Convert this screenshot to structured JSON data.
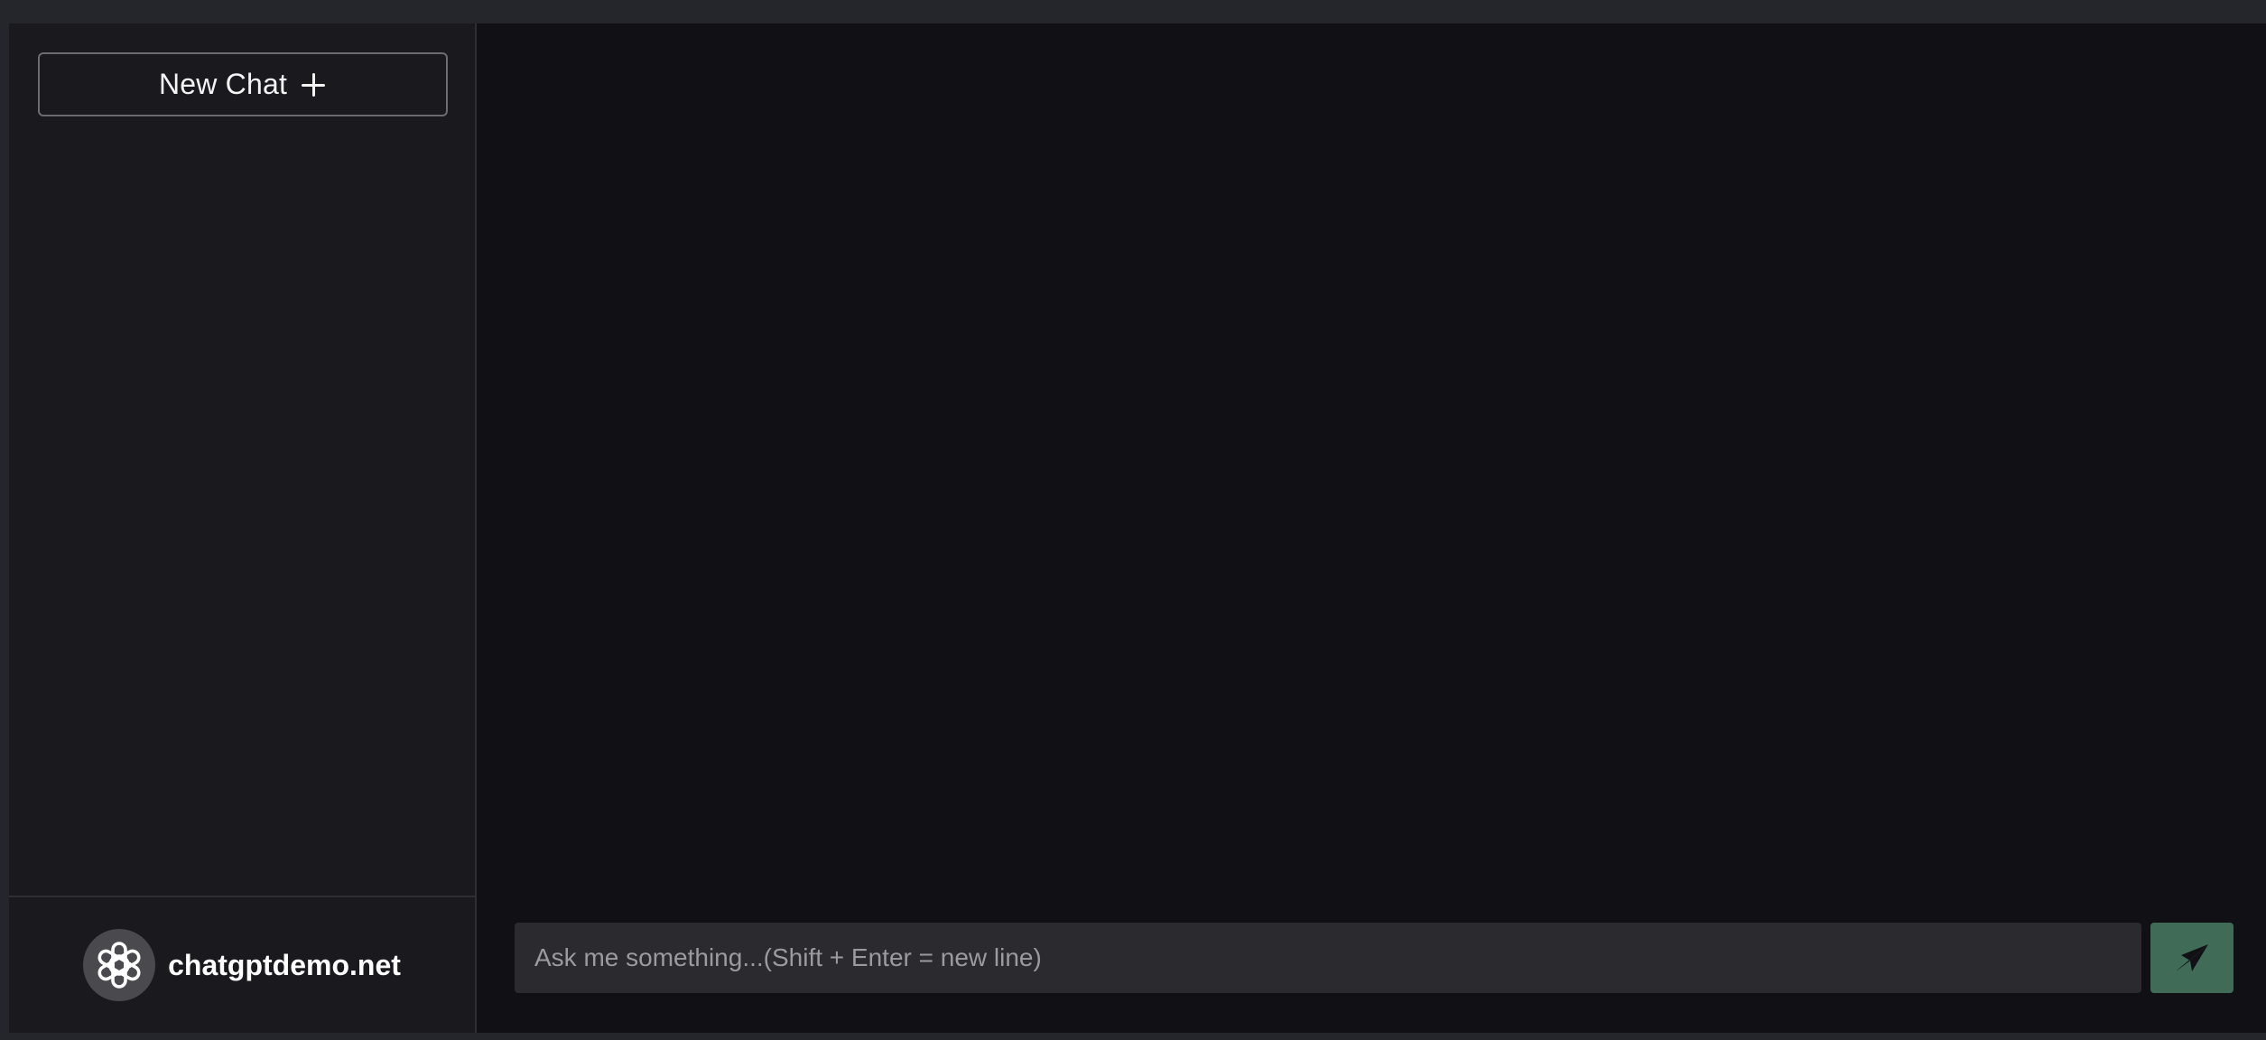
{
  "sidebar": {
    "new_chat_label": "New Chat",
    "new_chat_icon": "plus-icon",
    "brand_name": "chatgptdemo.net",
    "brand_icon": "openai-logo-icon"
  },
  "composer": {
    "placeholder": "Ask me something...(Shift + Enter = new line)",
    "value": "",
    "send_icon": "send-icon"
  },
  "colors": {
    "page_background": "#25262b",
    "sidebar_background": "#1a1a1e",
    "main_background": "#111014",
    "input_background": "#2a2a2f",
    "send_button": "#3f6b57"
  }
}
